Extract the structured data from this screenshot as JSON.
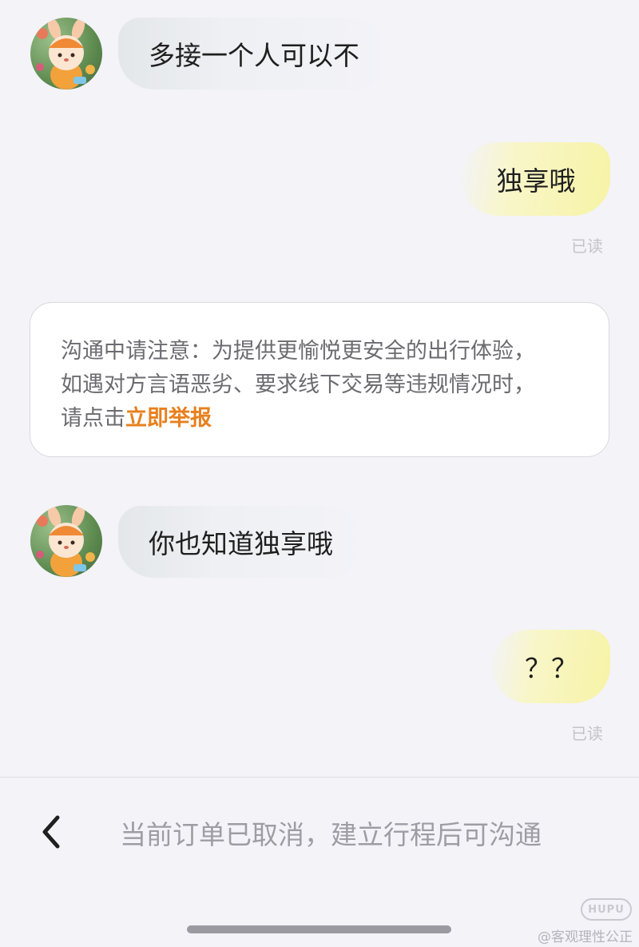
{
  "messages": [
    {
      "side": "left",
      "text": "多接一个人可以不"
    },
    {
      "side": "right",
      "text": "独享哦",
      "status": "已读"
    },
    {
      "side": "left",
      "text": "你也知道独享哦"
    },
    {
      "side": "right",
      "text": "？？",
      "status": "已读"
    }
  ],
  "notice": {
    "line1": "沟通中请注意：为提供更愉悦更安全的出行体验，",
    "line2": "如遇对方言语恶劣、要求线下交易等违规情况时，",
    "line3_prefix": "请点击",
    "report_link": "立即举报"
  },
  "footer": {
    "back_icon": "chevron-left-icon",
    "status_text": "当前订单已取消，建立行程后可沟通"
  },
  "watermark": {
    "logo": "HUPU",
    "text": "@客观理性公正"
  },
  "colors": {
    "background": "#f3f3f8",
    "link_orange": "#e8801e",
    "own_bubble": "#f7f3a6",
    "other_bubble": "#e4e7ea"
  }
}
